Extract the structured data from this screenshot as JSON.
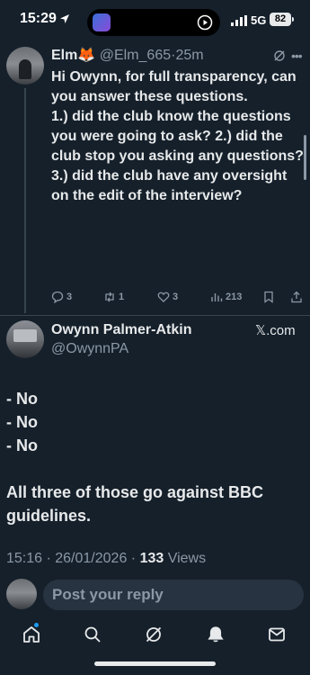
{
  "status_bar": {
    "time": "15:29",
    "network": "5G",
    "battery": "82"
  },
  "reply_tweet": {
    "name": "Elm🦊",
    "handle": "@Elm_665",
    "separator": "·",
    "time": "25m",
    "text": "Hi Owynn, for full transparency, can you answer these questions.\n1.) did the club know the questions you were going to ask? 2.) did the club stop you asking any questions?\n3.) did the club have any oversight on the edit of the interview?",
    "replies": "3",
    "retweets": "1",
    "likes": "3",
    "views": "213"
  },
  "main_tweet": {
    "name": "Owynn Palmer-Atkin",
    "handle": "@OwynnPA",
    "source": "𝕏.com",
    "lines": [
      "- No",
      "- No",
      "- No"
    ],
    "closing": "All three of those go against BBC guidelines.",
    "timestamp": "15:16 · 26/01/2026 · ",
    "views_count": "133",
    "views_label": " Views"
  },
  "reply_box": {
    "placeholder": "Post your reply"
  },
  "icons": {
    "tabs": [
      "home-icon",
      "search-icon",
      "grok-icon",
      "notifications-icon",
      "messages-icon"
    ]
  },
  "colors": {
    "background": "#15202b",
    "accent": "#1d9bf0",
    "muted": "#8b98a5"
  }
}
